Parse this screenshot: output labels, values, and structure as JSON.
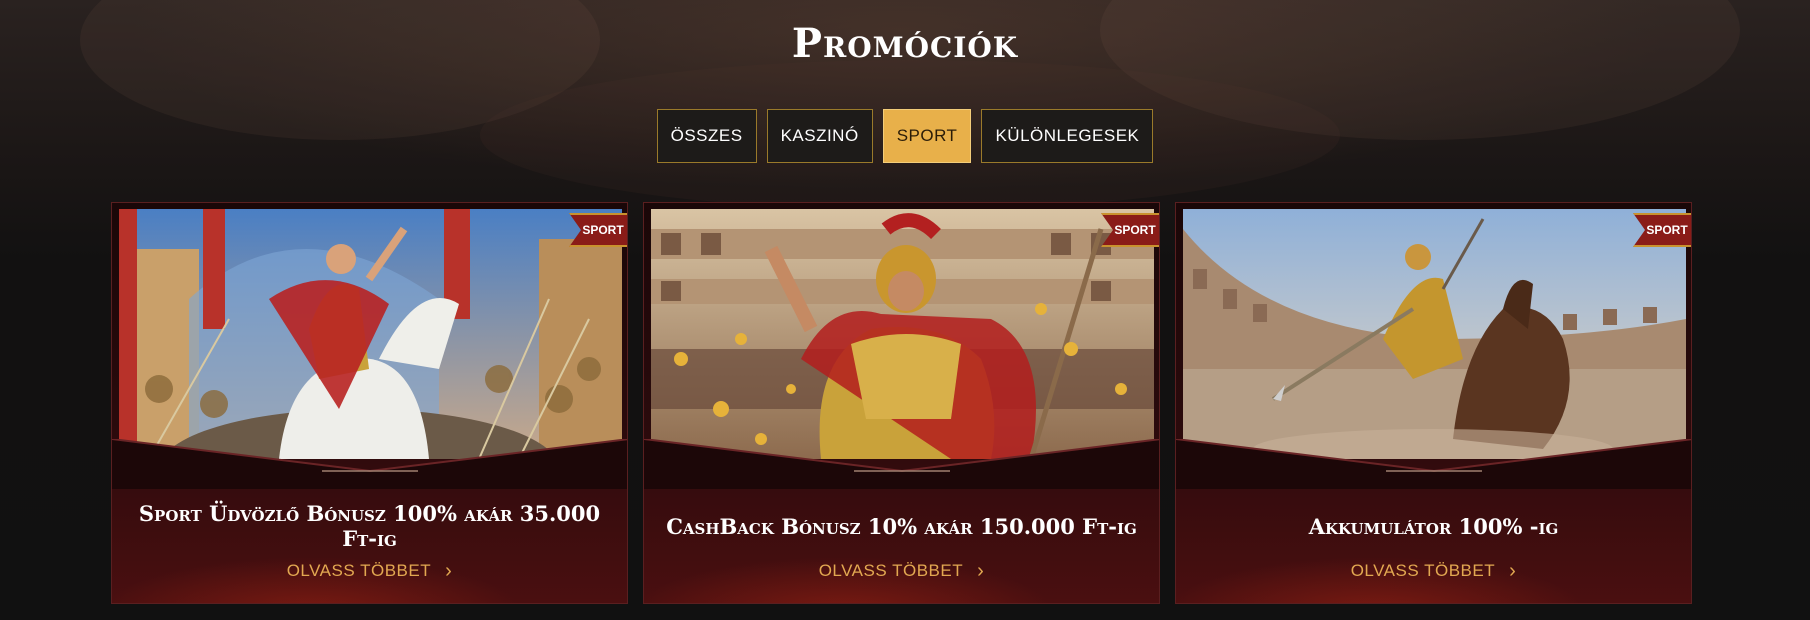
{
  "page": {
    "title": "Promóciók"
  },
  "tabs": [
    {
      "label": "ÖSSZES",
      "active": false
    },
    {
      "label": "KASZINÓ",
      "active": false
    },
    {
      "label": "SPORT",
      "active": true
    },
    {
      "label": "KÜLÖNLEGESEK",
      "active": false
    }
  ],
  "cards": [
    {
      "badge": "SPORT",
      "title": "Sport Üdvözlő Bónusz 100% akár 35.000 Ft-ig",
      "read_more": "OLVASS TÖBBET"
    },
    {
      "badge": "SPORT",
      "title": "CashBack Bónusz 10% akár 150.000 Ft-ig",
      "read_more": "OLVASS TÖBBET"
    },
    {
      "badge": "SPORT",
      "title": "Akkumulátor 100% -ig",
      "read_more": "OLVASS TÖBBET"
    }
  ],
  "colors": {
    "accent": "#e8b04a",
    "link": "#e2a851",
    "badge": "#8a1c18",
    "card_bg": "#2a0a0c"
  },
  "icons": {
    "read_more": "chevron-right-icon"
  }
}
